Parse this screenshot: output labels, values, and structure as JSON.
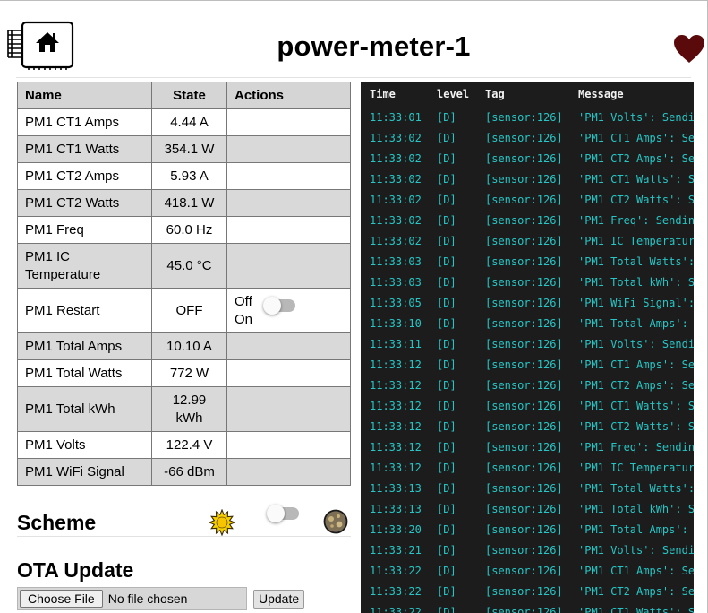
{
  "header": {
    "title": "power-meter-1",
    "logo_icon": "home-chip-icon",
    "heart_icon": "heart-icon",
    "heart_color": "#5a0a0a"
  },
  "entities": {
    "headers": [
      "Name",
      "State",
      "Actions"
    ],
    "rows": [
      {
        "name": "PM1 CT1 Amps",
        "state": "4.44 A"
      },
      {
        "name": "PM1 CT1 Watts",
        "state": "354.1 W"
      },
      {
        "name": "PM1 CT2 Amps",
        "state": "5.93 A"
      },
      {
        "name": "PM1 CT2 Watts",
        "state": "418.1 W"
      },
      {
        "name": "PM1 Freq",
        "state": "60.0 Hz"
      },
      {
        "name": "PM1 IC Temperature",
        "state": "45.0 °C"
      },
      {
        "name": "PM1 Restart",
        "state": "OFF",
        "action_off": "Off",
        "action_on": "On"
      },
      {
        "name": "PM1 Total Amps",
        "state": "10.10 A"
      },
      {
        "name": "PM1 Total Watts",
        "state": "772 W"
      },
      {
        "name": "PM1 Total kWh",
        "state": "12.99 kWh"
      },
      {
        "name": "PM1 Volts",
        "state": "122.4 V"
      },
      {
        "name": "PM1 WiFi Signal",
        "state": "-66 dBm"
      }
    ]
  },
  "scheme": {
    "title": "Scheme",
    "sun_icon": "sun-icon",
    "moon_icon": "moon-icon"
  },
  "ota": {
    "title": "OTA Update",
    "choose_label": "Choose File",
    "no_file": "No file chosen",
    "update_label": "Update"
  },
  "log": {
    "headers": {
      "time": "Time",
      "level": "level",
      "tag": "Tag",
      "message": "Message"
    },
    "color": "#27c5c5",
    "rows": [
      {
        "time": "11:33:01",
        "level": "[D]",
        "tag": "[sensor:126]",
        "msg": "'PM1 Volts': Sendi"
      },
      {
        "time": "11:33:02",
        "level": "[D]",
        "tag": "[sensor:126]",
        "msg": "'PM1 CT1 Amps': Se"
      },
      {
        "time": "11:33:02",
        "level": "[D]",
        "tag": "[sensor:126]",
        "msg": "'PM1 CT2 Amps': Se"
      },
      {
        "time": "11:33:02",
        "level": "[D]",
        "tag": "[sensor:126]",
        "msg": "'PM1 CT1 Watts': S"
      },
      {
        "time": "11:33:02",
        "level": "[D]",
        "tag": "[sensor:126]",
        "msg": "'PM1 CT2 Watts': S"
      },
      {
        "time": "11:33:02",
        "level": "[D]",
        "tag": "[sensor:126]",
        "msg": "'PM1 Freq': Sendin"
      },
      {
        "time": "11:33:02",
        "level": "[D]",
        "tag": "[sensor:126]",
        "msg": "'PM1 IC Temperatur"
      },
      {
        "time": "11:33:03",
        "level": "[D]",
        "tag": "[sensor:126]",
        "msg": "'PM1 Total Watts':"
      },
      {
        "time": "11:33:03",
        "level": "[D]",
        "tag": "[sensor:126]",
        "msg": "'PM1 Total kWh': S"
      },
      {
        "time": "11:33:05",
        "level": "[D]",
        "tag": "[sensor:126]",
        "msg": "'PM1 WiFi Signal':"
      },
      {
        "time": "11:33:10",
        "level": "[D]",
        "tag": "[sensor:126]",
        "msg": "'PM1 Total Amps':"
      },
      {
        "time": "11:33:11",
        "level": "[D]",
        "tag": "[sensor:126]",
        "msg": "'PM1 Volts': Sendi"
      },
      {
        "time": "11:33:12",
        "level": "[D]",
        "tag": "[sensor:126]",
        "msg": "'PM1 CT1 Amps': Se"
      },
      {
        "time": "11:33:12",
        "level": "[D]",
        "tag": "[sensor:126]",
        "msg": "'PM1 CT2 Amps': Se"
      },
      {
        "time": "11:33:12",
        "level": "[D]",
        "tag": "[sensor:126]",
        "msg": "'PM1 CT1 Watts': S"
      },
      {
        "time": "11:33:12",
        "level": "[D]",
        "tag": "[sensor:126]",
        "msg": "'PM1 CT2 Watts': S"
      },
      {
        "time": "11:33:12",
        "level": "[D]",
        "tag": "[sensor:126]",
        "msg": "'PM1 Freq': Sendin"
      },
      {
        "time": "11:33:12",
        "level": "[D]",
        "tag": "[sensor:126]",
        "msg": "'PM1 IC Temperatur"
      },
      {
        "time": "11:33:13",
        "level": "[D]",
        "tag": "[sensor:126]",
        "msg": "'PM1 Total Watts':"
      },
      {
        "time": "11:33:13",
        "level": "[D]",
        "tag": "[sensor:126]",
        "msg": "'PM1 Total kWh': S"
      },
      {
        "time": "11:33:20",
        "level": "[D]",
        "tag": "[sensor:126]",
        "msg": "'PM1 Total Amps':"
      },
      {
        "time": "11:33:21",
        "level": "[D]",
        "tag": "[sensor:126]",
        "msg": "'PM1 Volts': Sendi"
      },
      {
        "time": "11:33:22",
        "level": "[D]",
        "tag": "[sensor:126]",
        "msg": "'PM1 CT1 Amps': Se"
      },
      {
        "time": "11:33:22",
        "level": "[D]",
        "tag": "[sensor:126]",
        "msg": "'PM1 CT2 Amps': Se"
      },
      {
        "time": "11:33:22",
        "level": "[D]",
        "tag": "[sensor:126]",
        "msg": "'PM1 CT1 Watts': S"
      }
    ]
  }
}
